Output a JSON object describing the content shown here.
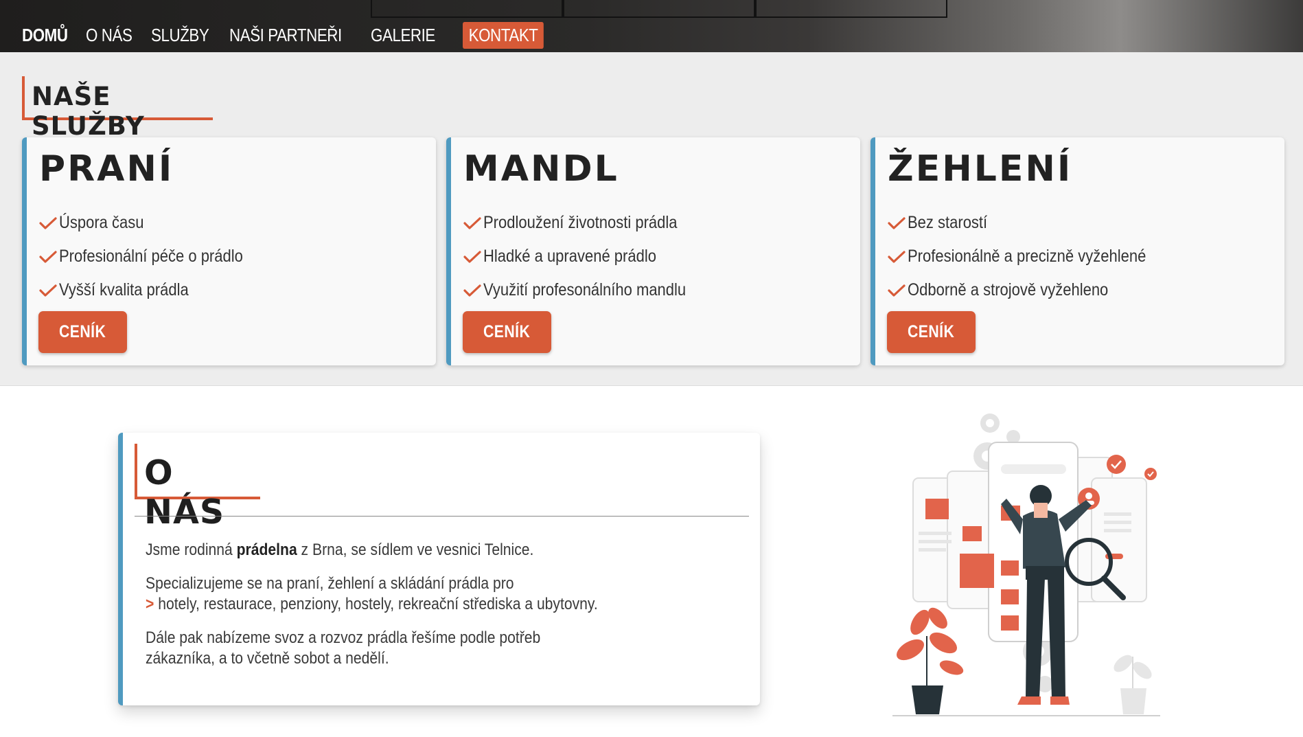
{
  "nav": {
    "items": [
      {
        "label": "DOMŮ",
        "active": true
      },
      {
        "label": "O NÁS"
      },
      {
        "label": "SLUŽBY"
      },
      {
        "label": "NAŠI PARTNEŘI"
      },
      {
        "label": "GALERIE"
      }
    ],
    "contact_label": "KONTAKT"
  },
  "services": {
    "heading": "NAŠE SLUŽBY",
    "cards": [
      {
        "title": "PRANÍ",
        "features": [
          "Úspora času",
          "Profesionální péče o prádlo",
          "Vyšší kvalita prádla"
        ],
        "button": "CENÍK"
      },
      {
        "title": "MANDL",
        "features": [
          "Prodloužení životnosti prádla",
          "Hladké a upravené prádlo",
          "Využití profesonálního mandlu"
        ],
        "button": "CENÍK"
      },
      {
        "title": "ŽEHLENÍ",
        "features": [
          "Bez starostí",
          "Profesionálně a precizně vyžehlené",
          "Odborně a strojově vyžehleno"
        ],
        "button": "CENÍK"
      }
    ]
  },
  "about": {
    "heading": "O NÁS",
    "p1_pre": "Jsme rodinná ",
    "p1_bold": "prádelna",
    "p1_post": " z Brna, se sídlem ve vesnici Telnice.",
    "p2_line1": "Specializujeme se na praní, žehlení a skládání prádla pro",
    "p2_arrow": ">",
    "p2_line2": " hotely, restaurace, penziony, hostely, rekreační střediska a ubytovny.",
    "p3": "Dále pak nabízeme svoz a rozvoz prádla řešíme podle potřeb zákazníka, a to včetně sobot a nedělí."
  },
  "colors": {
    "accent": "#d75a37",
    "card_border": "#4f9ac0",
    "services_bg": "#ededed",
    "text": "#333333"
  }
}
